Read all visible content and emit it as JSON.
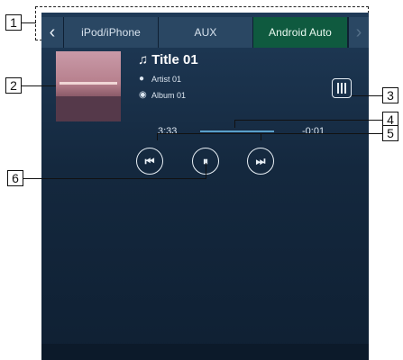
{
  "tabs": {
    "back_icon": "chevron-left-icon",
    "items": [
      "iPod/iPhone",
      "AUX",
      "Android Auto"
    ],
    "active_index": 2,
    "forward_icon": "chevron-right-icon"
  },
  "track": {
    "title": "Title 01",
    "artist": "Artist 01",
    "album": "Album 01"
  },
  "playback": {
    "elapsed": "3:33",
    "remaining": "-0:01",
    "progress": 0.99
  },
  "callouts": [
    "1",
    "2",
    "3",
    "4",
    "5",
    "6"
  ],
  "colors": {
    "active_tab": "#0f5a3f",
    "background": "#14283e",
    "progress": "#5aa0c9"
  }
}
